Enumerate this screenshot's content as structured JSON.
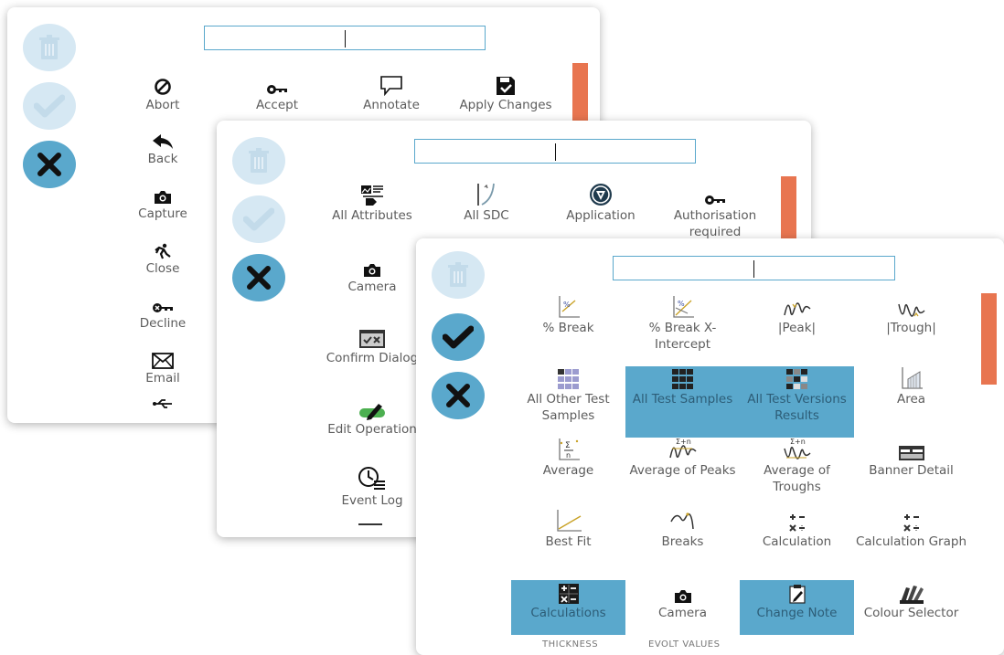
{
  "panel1": {
    "search": {
      "value": ""
    },
    "items": [
      {
        "label": "Abort",
        "icon": "abort-icon"
      },
      {
        "label": "Accept",
        "icon": "key-icon"
      },
      {
        "label": "Annotate",
        "icon": "annotate-icon"
      },
      {
        "label": "Apply Changes",
        "icon": "apply-changes-icon"
      },
      {
        "label": "Back",
        "icon": "back-arrow-icon"
      },
      {
        "label": "Capture",
        "icon": "camera-icon"
      },
      {
        "label": "Close",
        "icon": "close-run-icon"
      },
      {
        "label": "Decline",
        "icon": "decline-key-icon"
      },
      {
        "label": "Email",
        "icon": "email-icon"
      }
    ]
  },
  "panel2": {
    "search": {
      "value": ""
    },
    "items": [
      {
        "label": "All Attributes",
        "icon": "attributes-icon"
      },
      {
        "label": "All SDC",
        "icon": "sdc-icon"
      },
      {
        "label": "Application",
        "icon": "application-icon"
      },
      {
        "label": "Authorisation required",
        "icon": "key-icon"
      },
      {
        "label": "Camera",
        "icon": "camera-icon"
      },
      {
        "label": "Confirm Dialog",
        "icon": "confirm-dialog-icon"
      },
      {
        "label": "Edit Operation",
        "icon": "edit-operation-icon"
      },
      {
        "label": "Event Log",
        "icon": "event-log-icon"
      }
    ]
  },
  "panel3": {
    "search": {
      "value": ""
    },
    "items": [
      {
        "label": "% Break",
        "icon": "percent-break-icon"
      },
      {
        "label": "% Break X-Intercept",
        "icon": "percent-break-x-intercept-icon"
      },
      {
        "label": "|Peak|",
        "icon": "peak-icon"
      },
      {
        "label": "|Trough|",
        "icon": "trough-icon"
      },
      {
        "label": "All Other Test Samples",
        "icon": "grid-light-icon"
      },
      {
        "label": "All Test Samples",
        "icon": "grid-dark-icon",
        "selected": true
      },
      {
        "label": "All Test Versions Results",
        "icon": "grid-mixed-icon",
        "selected": true
      },
      {
        "label": "Area",
        "icon": "area-icon"
      },
      {
        "label": "Average",
        "icon": "average-icon"
      },
      {
        "label": "Average of Peaks",
        "icon": "average-peaks-icon"
      },
      {
        "label": "Average of Troughs",
        "icon": "average-troughs-icon"
      },
      {
        "label": "Banner Detail",
        "icon": "banner-detail-icon"
      },
      {
        "label": "Best Fit",
        "icon": "best-fit-icon"
      },
      {
        "label": "Breaks",
        "icon": "breaks-icon"
      },
      {
        "label": "Calculation",
        "icon": "calculation-icon"
      },
      {
        "label": "Calculation Graph",
        "icon": "calculation-graph-icon"
      },
      {
        "label": "Calculations",
        "icon": "calculations-icon",
        "selected": true
      },
      {
        "label": "Camera",
        "icon": "camera-icon"
      },
      {
        "label": "Change Note",
        "icon": "change-note-icon",
        "selected": true
      },
      {
        "label": "Colour Selector",
        "icon": "colour-selector-icon"
      }
    ],
    "partial_labels": [
      "THICKNESS",
      "EVOLT VALUES"
    ]
  },
  "colors": {
    "accent": "#5aa8cc",
    "accent_light": "#d6e8f3",
    "scrollbar": "#e87550",
    "selected_text": "#2d5d77"
  }
}
